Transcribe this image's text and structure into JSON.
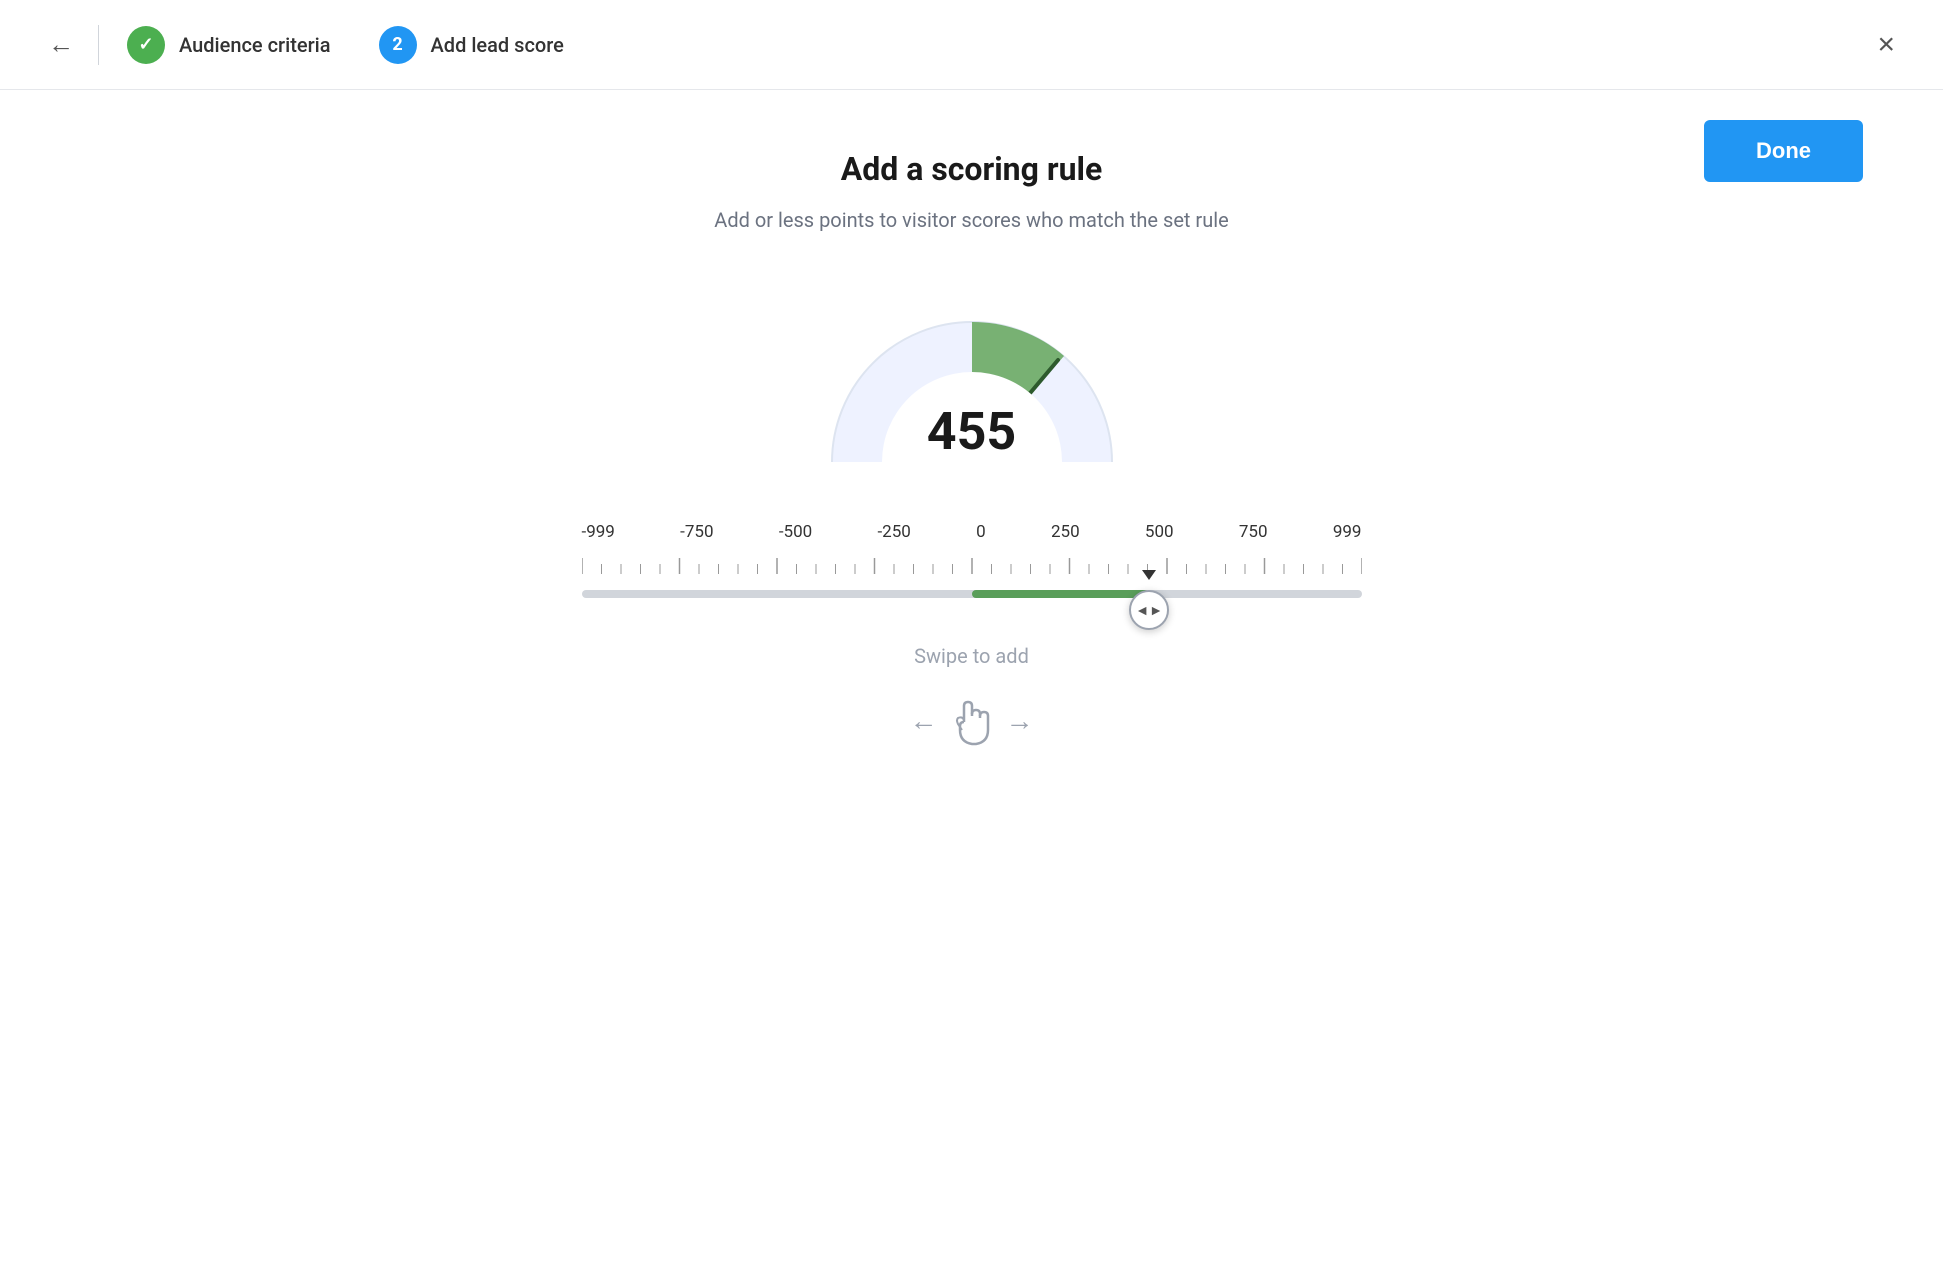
{
  "header": {
    "back_label": "←",
    "close_label": "×",
    "step1": {
      "badge": "✓",
      "badge_type": "green",
      "label": "Audience criteria"
    },
    "step2": {
      "badge": "2",
      "badge_type": "blue",
      "label": "Add lead score"
    }
  },
  "main": {
    "done_label": "Done",
    "title": "Add a scoring rule",
    "subtitle": "Add or less points to visitor scores who match the set rule",
    "gauge_value": "455",
    "slider": {
      "min": -999,
      "max": 999,
      "value": 455,
      "scale_labels": [
        "-999",
        "-750",
        "-500",
        "-250",
        "0",
        "250",
        "500",
        "750",
        "999"
      ]
    },
    "swipe_label": "Swipe to add"
  }
}
